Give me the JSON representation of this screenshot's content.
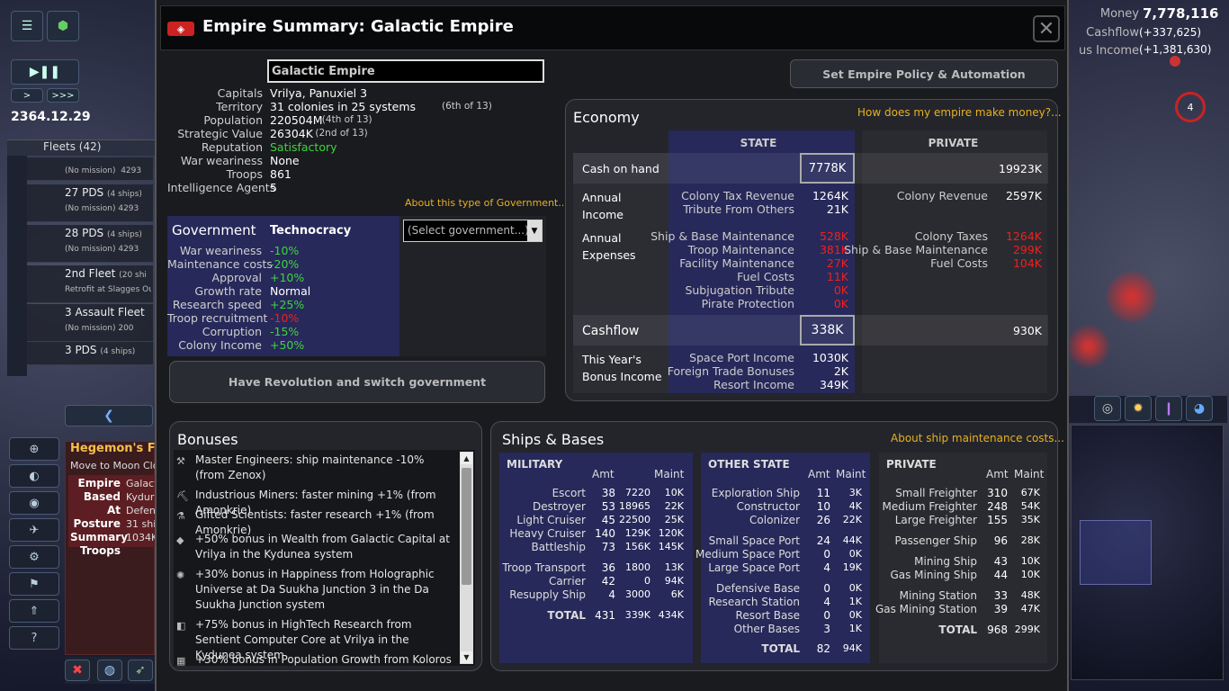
{
  "game": {
    "date": "2364.12.29",
    "fleets_header": "Fleets (42)"
  },
  "fleets": [
    {
      "name": "27 PDS",
      "ships": "(4 ships)",
      "status": "(No mission)",
      "extra": "4293"
    },
    {
      "name": "28 PDS",
      "ships": "(4 ships)",
      "status": "(No mission)",
      "extra": "4293"
    },
    {
      "name": "2nd Fleet",
      "ships": "(20 shi",
      "status": "Retrofit at Slagges Outp",
      "extra": ""
    },
    {
      "name": "3 Assault Fleet",
      "ships": "",
      "status": "(No mission)",
      "extra": "200"
    },
    {
      "name": "3 PDS",
      "ships": "(4 ships)",
      "status": "",
      "extra": ""
    }
  ],
  "selected": {
    "name": "Hegemon's F",
    "mission": "Move to Moon Clote",
    "rows": [
      {
        "k": "Empire",
        "v": "Galact"
      },
      {
        "k": "Based At",
        "v": "Kydur"
      },
      {
        "k": "Posture",
        "v": "Defen"
      },
      {
        "k": "Summary",
        "v": "31 shi"
      },
      {
        "k": "Troops",
        "v": "1034K"
      }
    ]
  },
  "topbar": {
    "money_label": "Money",
    "money": "7,778,116",
    "cashflow_label": "Cashflow",
    "cashflow": "(+337,625)",
    "bonus_label": "us Income",
    "bonus": "(+1,381,630)"
  },
  "dialog": {
    "title": "Empire Summary: Galactic Empire",
    "close": "✕"
  },
  "empire": {
    "name_input": "Galactic Empire",
    "policy_button": "Set Empire Policy & Automation",
    "rows": [
      {
        "k": "Capitals",
        "v": "Vrilya, Panuxiel 3",
        "r": ""
      },
      {
        "k": "Territory",
        "v": "31 colonies in 25 systems",
        "r": "(6th of 13)"
      },
      {
        "k": "Population",
        "v": "220504M",
        "r": "(4th of 13)"
      },
      {
        "k": "Strategic Value",
        "v": "26304K",
        "r": "(2nd of 13)"
      },
      {
        "k": "Reputation",
        "v": "Satisfactory",
        "r": ""
      },
      {
        "k": "War weariness",
        "v": "None",
        "r": ""
      },
      {
        "k": "Troops",
        "v": "861",
        "r": ""
      },
      {
        "k": "Intelligence Agents",
        "v": "5",
        "r": ""
      }
    ],
    "about_gov": "About this type of Government..."
  },
  "government": {
    "label": "Government",
    "type": "Technocracy",
    "select_placeholder": "(Select government...)",
    "rows": [
      {
        "k": "War weariness",
        "v": "-10%",
        "c": "green"
      },
      {
        "k": "Maintenance costs",
        "v": "-20%",
        "c": "green"
      },
      {
        "k": "Approval",
        "v": "+10%",
        "c": "green"
      },
      {
        "k": "Growth rate",
        "v": "Normal",
        "c": "white"
      },
      {
        "k": "Research speed",
        "v": "+25%",
        "c": "green"
      },
      {
        "k": "Troop recruitment",
        "v": "-10%",
        "c": "red"
      },
      {
        "k": "Corruption",
        "v": "-15%",
        "c": "green"
      },
      {
        "k": "Colony Income",
        "v": "+50%",
        "c": "green"
      }
    ],
    "revolution_button": "Have Revolution and switch government"
  },
  "economy": {
    "title": "Economy",
    "help_link": "How does my empire make money?...",
    "state_header": "STATE",
    "private_header": "PRIVATE",
    "cash_label": "Cash on hand",
    "cash_state": "7778K",
    "cash_private": "19923K",
    "income_label": "Annual Income",
    "income_state": [
      {
        "k": "Colony Tax Revenue",
        "v": "1264K"
      },
      {
        "k": "Tribute From Others",
        "v": "21K"
      }
    ],
    "income_private": [
      {
        "k": "Colony Revenue",
        "v": "2597K"
      }
    ],
    "expense_label": "Annual Expenses",
    "expense_state": [
      {
        "k": "Ship & Base Maintenance",
        "v": "528K"
      },
      {
        "k": "Troop Maintenance",
        "v": "381K"
      },
      {
        "k": "Facility Maintenance",
        "v": "27K"
      },
      {
        "k": "Fuel Costs",
        "v": "11K"
      },
      {
        "k": "Subjugation Tribute",
        "v": "0K"
      },
      {
        "k": "Pirate Protection",
        "v": "0K"
      }
    ],
    "expense_private": [
      {
        "k": "Colony Taxes",
        "v": "1264K"
      },
      {
        "k": "Ship & Base Maintenance",
        "v": "299K"
      },
      {
        "k": "Fuel Costs",
        "v": "104K"
      }
    ],
    "cashflow_label": "Cashflow",
    "cashflow_state": "338K",
    "cashflow_private": "930K",
    "bonus_label": "This Year's Bonus Income",
    "bonus_state": [
      {
        "k": "Space Port Income",
        "v": "1030K"
      },
      {
        "k": "Foreign Trade Bonuses",
        "v": "2K"
      },
      {
        "k": "Resort Income",
        "v": "349K"
      }
    ]
  },
  "bonuses": {
    "title": "Bonuses",
    "items": [
      {
        "icon": "engineer-icon",
        "text": "Master Engineers: ship maintenance -10% (from Zenox)"
      },
      {
        "icon": "miner-icon",
        "text": "Industrious Miners: faster mining +1% (from Amonkrie)"
      },
      {
        "icon": "scientist-icon",
        "text": "Gifted Scientists: faster research +1% (from Amonkrie)"
      },
      {
        "icon": "wealth-icon",
        "text": "+50% bonus in Wealth from Galactic Capital at Vrilya in the Kydunea system"
      },
      {
        "icon": "happiness-icon",
        "text": "+30% bonus in Happiness from Holographic Universe at Da Suukha Junction 3 in the Da Suukha Junction system"
      },
      {
        "icon": "research-icon",
        "text": "+75% bonus in HighTech Research from Sentient Computer Core at Vrilya in the Kydunea system"
      },
      {
        "icon": "population-icon",
        "text": "+30% bonus in Population Growth from Koloros"
      }
    ]
  },
  "ships": {
    "title": "Ships & Bases",
    "about_link": "About ship maintenance costs...",
    "amt_header": "Amt",
    "maint_header": "Maint",
    "military": {
      "title": "MILITARY",
      "rows": [
        {
          "n": "Escort",
          "a": "38",
          "m1": "7220",
          "m2": "10K"
        },
        {
          "n": "Destroyer",
          "a": "53",
          "m1": "18965",
          "m2": "22K"
        },
        {
          "n": "Light Cruiser",
          "a": "45",
          "m1": "22500",
          "m2": "25K"
        },
        {
          "n": "Heavy Cruiser",
          "a": "140",
          "m1": "129K",
          "m2": "120K"
        },
        {
          "n": "Battleship",
          "a": "73",
          "m1": "156K",
          "m2": "145K"
        },
        {
          "n": "Troop Transport",
          "a": "36",
          "m1": "1800",
          "m2": "13K"
        },
        {
          "n": "Carrier",
          "a": "42",
          "m1": "0",
          "m2": "94K"
        },
        {
          "n": "Resupply Ship",
          "a": "4",
          "m1": "3000",
          "m2": "6K"
        },
        {
          "n": "TOTAL",
          "a": "431",
          "m1": "339K",
          "m2": "434K"
        }
      ]
    },
    "other": {
      "title": "OTHER STATE",
      "rows": [
        {
          "n": "Exploration Ship",
          "a": "11",
          "m": "3K"
        },
        {
          "n": "Constructor",
          "a": "10",
          "m": "4K"
        },
        {
          "n": "Colonizer",
          "a": "26",
          "m": "22K"
        },
        {
          "n": "Small Space Port",
          "a": "24",
          "m": "44K"
        },
        {
          "n": "Medium Space Port",
          "a": "0",
          "m": "0K"
        },
        {
          "n": "Large Space Port",
          "a": "4",
          "m": "19K"
        },
        {
          "n": "Defensive Base",
          "a": "0",
          "m": "0K"
        },
        {
          "n": "Research Station",
          "a": "4",
          "m": "1K"
        },
        {
          "n": "Resort Base",
          "a": "0",
          "m": "0K"
        },
        {
          "n": "Other Bases",
          "a": "3",
          "m": "1K"
        },
        {
          "n": "TOTAL",
          "a": "82",
          "m": "94K"
        }
      ]
    },
    "private": {
      "title": "PRIVATE",
      "rows": [
        {
          "n": "Small Freighter",
          "a": "310",
          "m": "67K"
        },
        {
          "n": "Medium Freighter",
          "a": "248",
          "m": "54K"
        },
        {
          "n": "Large Freighter",
          "a": "155",
          "m": "35K"
        },
        {
          "n": "Passenger Ship",
          "a": "96",
          "m": "28K"
        },
        {
          "n": "Mining Ship",
          "a": "43",
          "m": "10K"
        },
        {
          "n": "Gas Mining Ship",
          "a": "44",
          "m": "10K"
        },
        {
          "n": "Mining Station",
          "a": "33",
          "m": "48K"
        },
        {
          "n": "Gas Mining Station",
          "a": "39",
          "m": "47K"
        },
        {
          "n": "TOTAL",
          "a": "968",
          "m": "299K"
        }
      ]
    }
  },
  "colors": {
    "accent_gold": "#e8b020",
    "positive": "#3fd43f",
    "negative": "#f02020",
    "state_col": "#27295a"
  }
}
